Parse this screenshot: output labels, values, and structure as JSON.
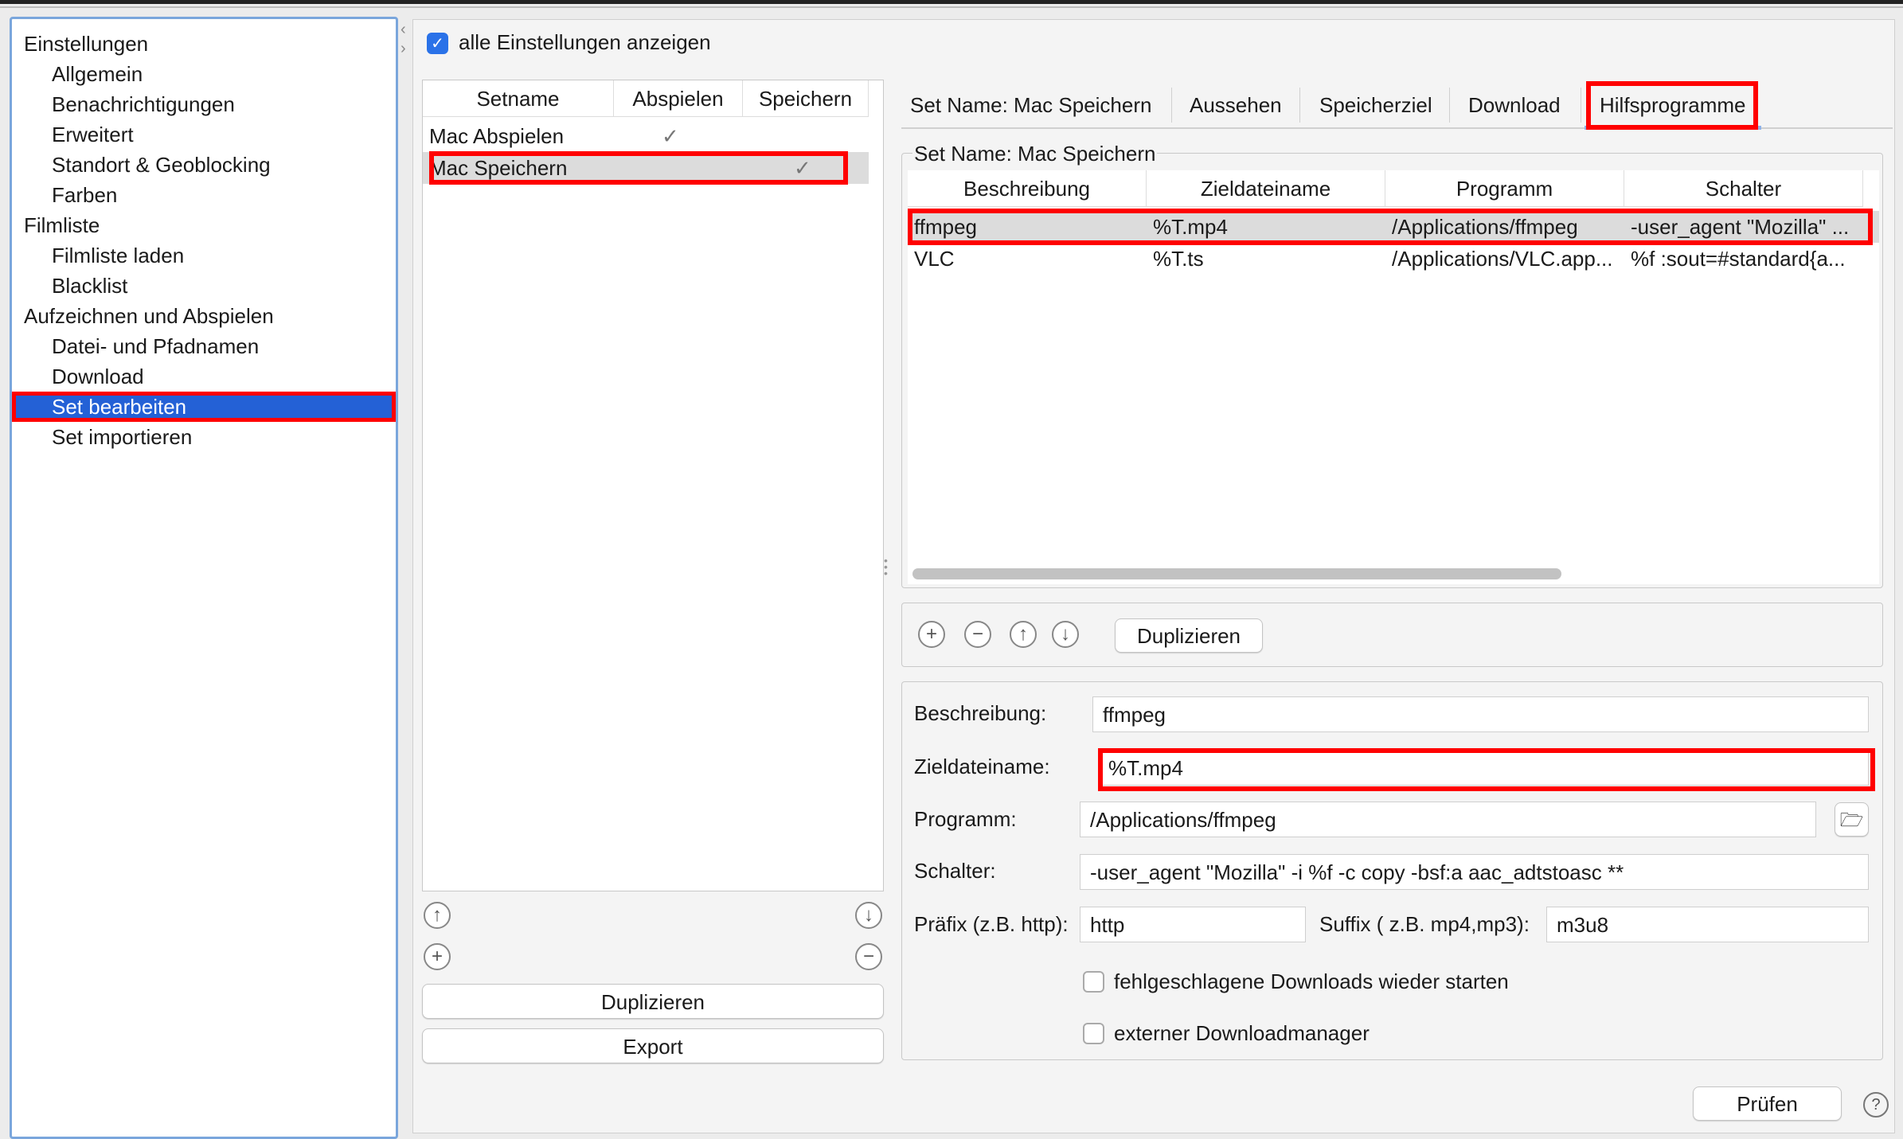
{
  "sidebar": {
    "items": [
      {
        "label": "Einstellungen",
        "level": 1
      },
      {
        "label": "Allgemein",
        "level": 2
      },
      {
        "label": "Benachrichtigungen",
        "level": 2
      },
      {
        "label": "Erweitert",
        "level": 2
      },
      {
        "label": "Standort & Geoblocking",
        "level": 2
      },
      {
        "label": "Farben",
        "level": 2
      },
      {
        "label": "Filmliste",
        "level": 1
      },
      {
        "label": "Filmliste laden",
        "level": 2
      },
      {
        "label": "Blacklist",
        "level": 2
      },
      {
        "label": "Aufzeichnen und Abspielen",
        "level": 1
      },
      {
        "label": "Datei- und Pfadnamen",
        "level": 2
      },
      {
        "label": "Download",
        "level": 2
      },
      {
        "label": "Set bearbeiten",
        "level": 2,
        "selected": true
      },
      {
        "label": "Set importieren",
        "level": 2
      }
    ]
  },
  "show_all": {
    "label": "alle Einstellungen anzeigen",
    "checked": true
  },
  "sets": {
    "columns": [
      "Setname",
      "Abspielen",
      "Speichern"
    ],
    "rows": [
      {
        "name": "Mac Abspielen",
        "play": "✓",
        "save": ""
      },
      {
        "name": "Mac Speichern",
        "play": "",
        "save": "✓",
        "selected": true
      }
    ],
    "duplicate": "Duplizieren",
    "export": "Export"
  },
  "tabs": [
    "Set Name: Mac Speichern",
    "Aussehen",
    "Speicherziel",
    "Download",
    "Hilfsprogramme"
  ],
  "active_tab": "Hilfsprogramme",
  "programs": {
    "group_title": "Set Name: Mac Speichern",
    "columns": [
      "Beschreibung",
      "Zieldateiname",
      "Programm",
      "Schalter"
    ],
    "rows": [
      {
        "desc": "ffmpeg",
        "target": "%T.mp4",
        "program": "/Applications/ffmpeg",
        "switch": "-user_agent \"Mozilla\" ...",
        "selected": true
      },
      {
        "desc": "VLC",
        "target": "%T.ts",
        "program": "/Applications/VLC.app...",
        "switch": "%f :sout=#standard{a..."
      }
    ],
    "duplicate": "Duplizieren"
  },
  "form": {
    "desc_label": "Beschreibung:",
    "desc": "ffmpeg",
    "target_label": "Zieldateiname:",
    "target": "%T.mp4",
    "program_label": "Programm:",
    "program": "/Applications/ffmpeg",
    "switch_label": "Schalter:",
    "switch": "-user_agent \"Mozilla\" -i %f -c copy -bsf:a aac_adtstoasc **",
    "prefix_label": "Präfix (z.B. http):",
    "prefix": "http",
    "suffix_label": "Suffix ( z.B. mp4,mp3):",
    "suffix": "m3u8",
    "restart_label": "fehlgeschlagene Downloads wieder starten",
    "external_label": "externer Downloadmanager"
  },
  "check_button": "Prüfen",
  "help": "?",
  "colors": {
    "selection": "#2461d6",
    "highlight": "#ff0000",
    "checkbox": "#2a72e8"
  }
}
